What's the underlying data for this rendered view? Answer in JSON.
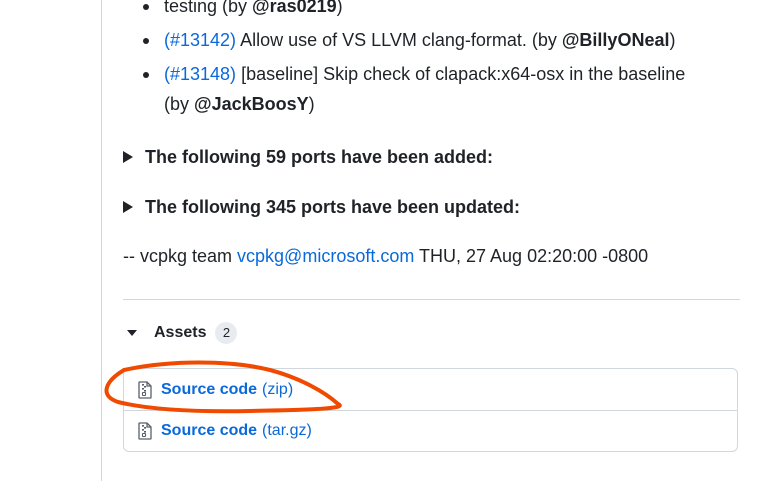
{
  "release_notes": {
    "bullets": [
      {
        "pr": "",
        "text": "testing (by ",
        "user": "@ras0219",
        "suffix": ")",
        "cont": ""
      },
      {
        "pr": "(#13142)",
        "text": " Allow use of VS LLVM clang-format. (by ",
        "user": "@BillyONeal",
        "suffix": ")",
        "cont": ""
      },
      {
        "pr": "(#13148)",
        "text": " [baseline] Skip check of clapack:x64-osx in the baseline",
        "user": "@JackBoosY",
        "suffix": ")",
        "cont": "(by "
      }
    ],
    "ports_added_summary": "The following 59 ports have been added:",
    "ports_updated_summary": "The following 345 ports have been updated:",
    "signature": {
      "prefix": "-- vcpkg team ",
      "email": "vcpkg@microsoft.com",
      "date": " THU, 27 Aug 02:20:00 -0800"
    }
  },
  "assets": {
    "title": "Assets",
    "count": "2",
    "items": [
      {
        "name": "Source code",
        "ext": "(zip)",
        "icon": "file-zip-icon"
      },
      {
        "name": "Source code",
        "ext": "(tar.gz)",
        "icon": "file-zip-icon"
      }
    ]
  },
  "colors": {
    "link": "#0969da",
    "annotation": "#f04a00"
  }
}
